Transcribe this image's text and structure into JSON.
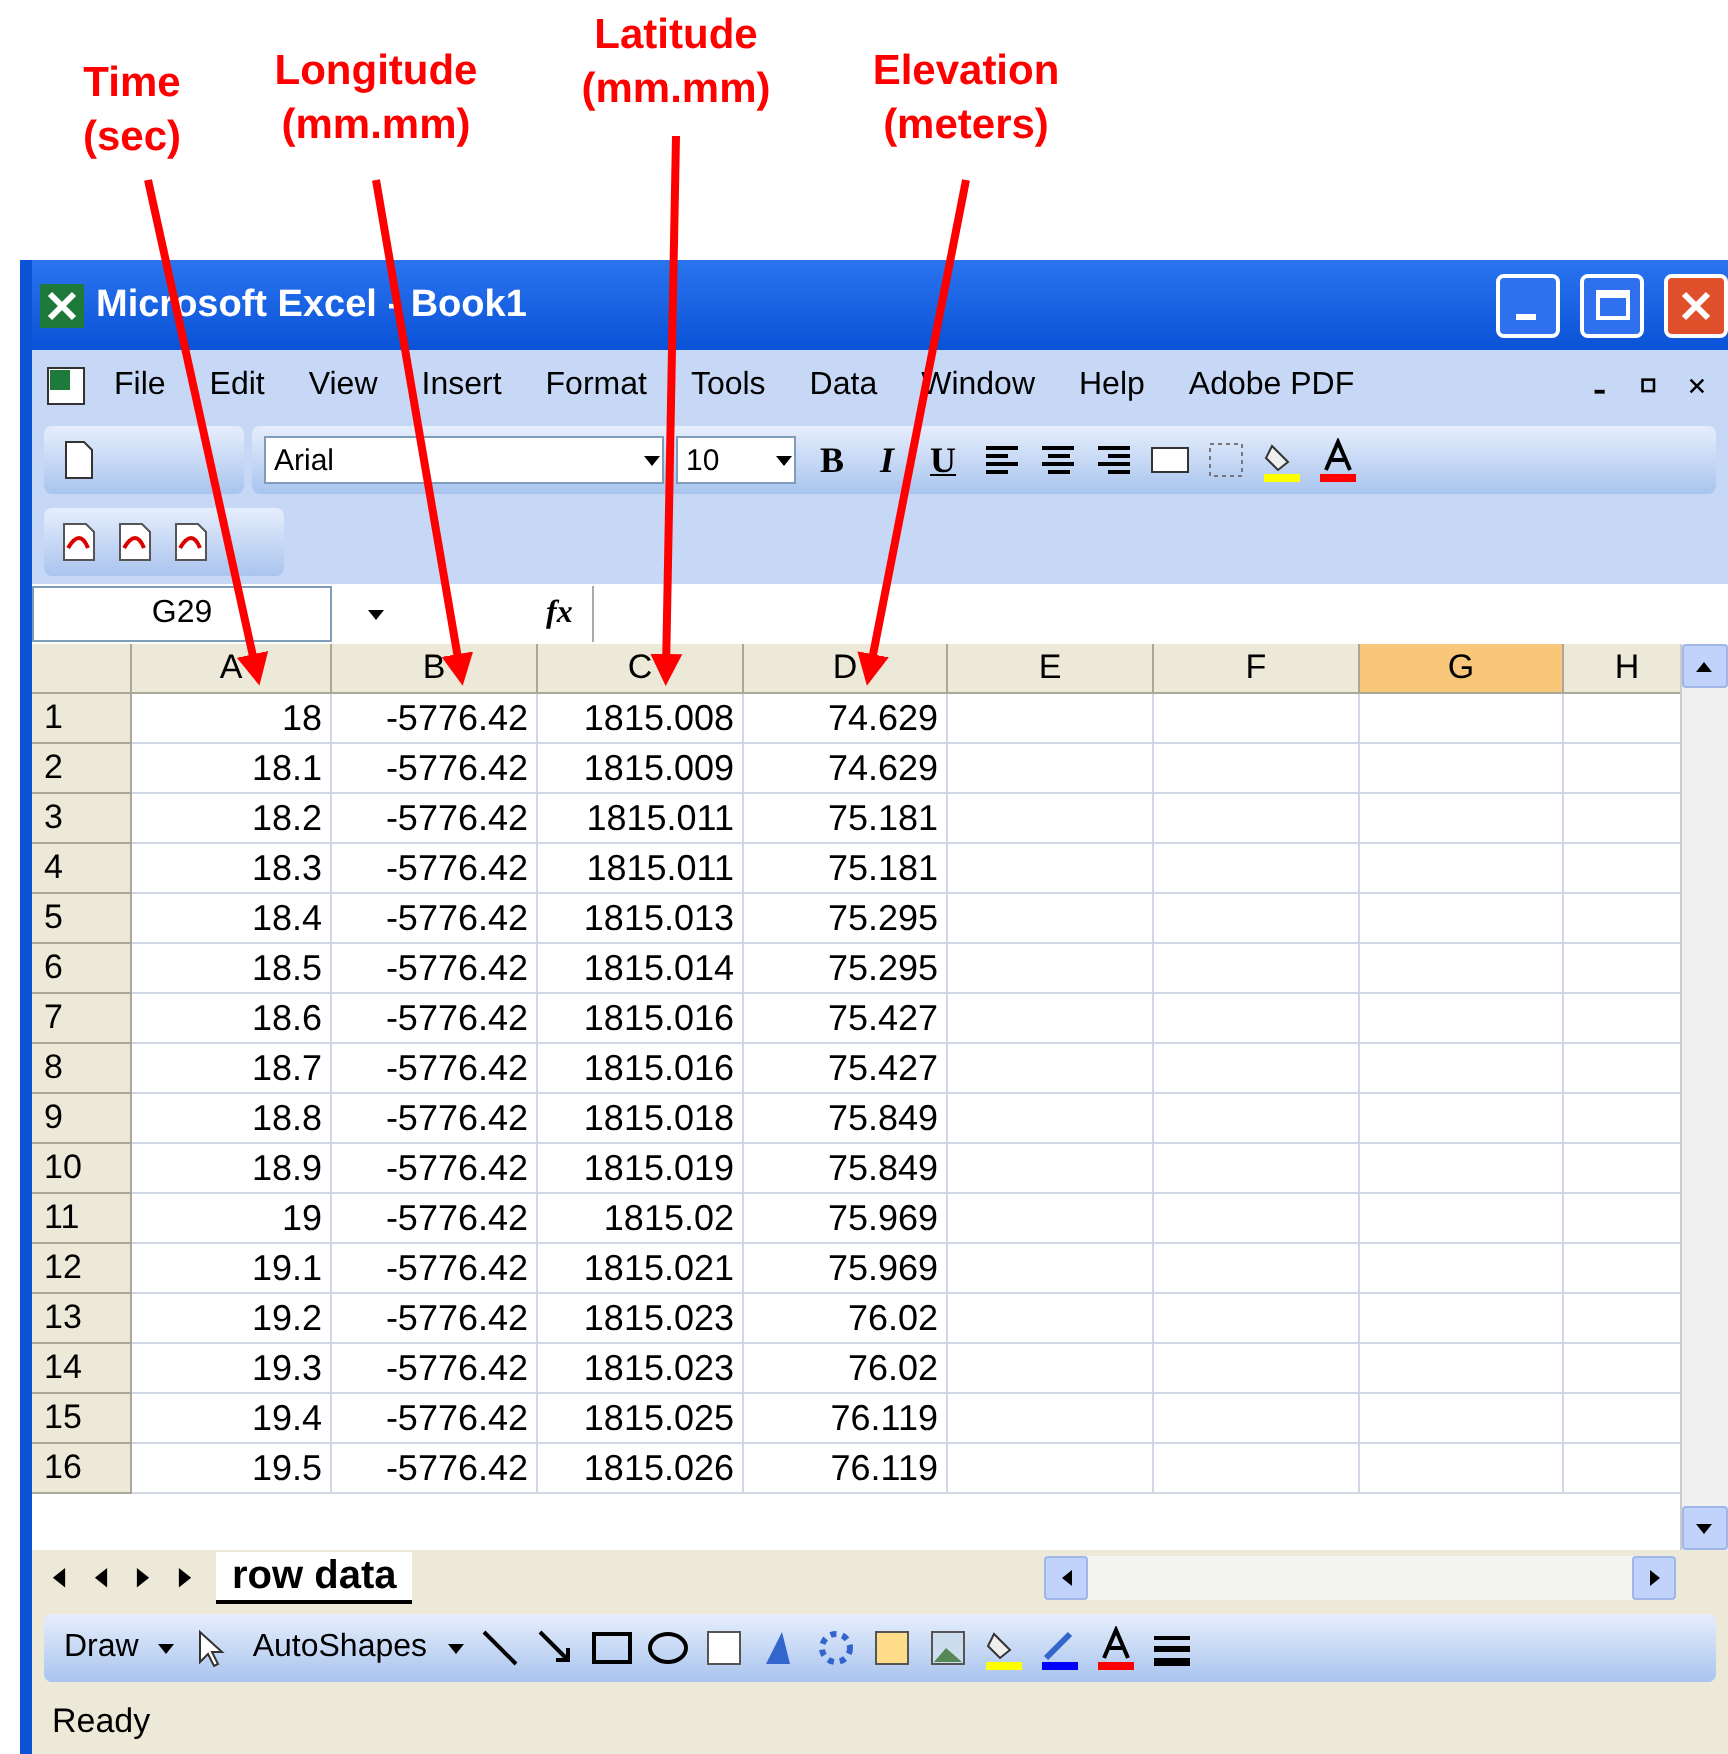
{
  "annotations": [
    {
      "label": "Time",
      "unit": "(sec)"
    },
    {
      "label": "Longitude",
      "unit": "(mm.mm)"
    },
    {
      "label": "Latitude",
      "unit": "(mm.mm)"
    },
    {
      "label": "Elevation",
      "unit": "(meters)"
    }
  ],
  "window": {
    "title": "Microsoft Excel - Book1"
  },
  "menu": [
    "File",
    "Edit",
    "View",
    "Insert",
    "Format",
    "Tools",
    "Data",
    "Window",
    "Help",
    "Adobe PDF"
  ],
  "formatting": {
    "font": "Arial",
    "size": "10",
    "bold": "B",
    "italic": "I",
    "underline": "U"
  },
  "name_box": "G29",
  "formula_label": "fx",
  "columns": [
    {
      "label": "A",
      "selected": false
    },
    {
      "label": "B",
      "selected": false
    },
    {
      "label": "C",
      "selected": false
    },
    {
      "label": "D",
      "selected": false
    },
    {
      "label": "E",
      "selected": false
    },
    {
      "label": "F",
      "selected": false
    },
    {
      "label": "G",
      "selected": true
    },
    {
      "label": "H",
      "selected": false
    }
  ],
  "rows": [
    [
      "1",
      "18",
      "-5776.42",
      "1815.008",
      "74.629"
    ],
    [
      "2",
      "18.1",
      "-5776.42",
      "1815.009",
      "74.629"
    ],
    [
      "3",
      "18.2",
      "-5776.42",
      "1815.011",
      "75.181"
    ],
    [
      "4",
      "18.3",
      "-5776.42",
      "1815.011",
      "75.181"
    ],
    [
      "5",
      "18.4",
      "-5776.42",
      "1815.013",
      "75.295"
    ],
    [
      "6",
      "18.5",
      "-5776.42",
      "1815.014",
      "75.295"
    ],
    [
      "7",
      "18.6",
      "-5776.42",
      "1815.016",
      "75.427"
    ],
    [
      "8",
      "18.7",
      "-5776.42",
      "1815.016",
      "75.427"
    ],
    [
      "9",
      "18.8",
      "-5776.42",
      "1815.018",
      "75.849"
    ],
    [
      "10",
      "18.9",
      "-5776.42",
      "1815.019",
      "75.849"
    ],
    [
      "11",
      "19",
      "-5776.42",
      "1815.02",
      "75.969"
    ],
    [
      "12",
      "19.1",
      "-5776.42",
      "1815.021",
      "75.969"
    ],
    [
      "13",
      "19.2",
      "-5776.42",
      "1815.023",
      "76.02"
    ],
    [
      "14",
      "19.3",
      "-5776.42",
      "1815.023",
      "76.02"
    ],
    [
      "15",
      "19.4",
      "-5776.42",
      "1815.025",
      "76.119"
    ],
    [
      "16",
      "19.5",
      "-5776.42",
      "1815.026",
      "76.119"
    ]
  ],
  "sheet_tab": "row data",
  "drawing": {
    "draw": "Draw",
    "autoshapes": "AutoShapes"
  },
  "status": "Ready"
}
